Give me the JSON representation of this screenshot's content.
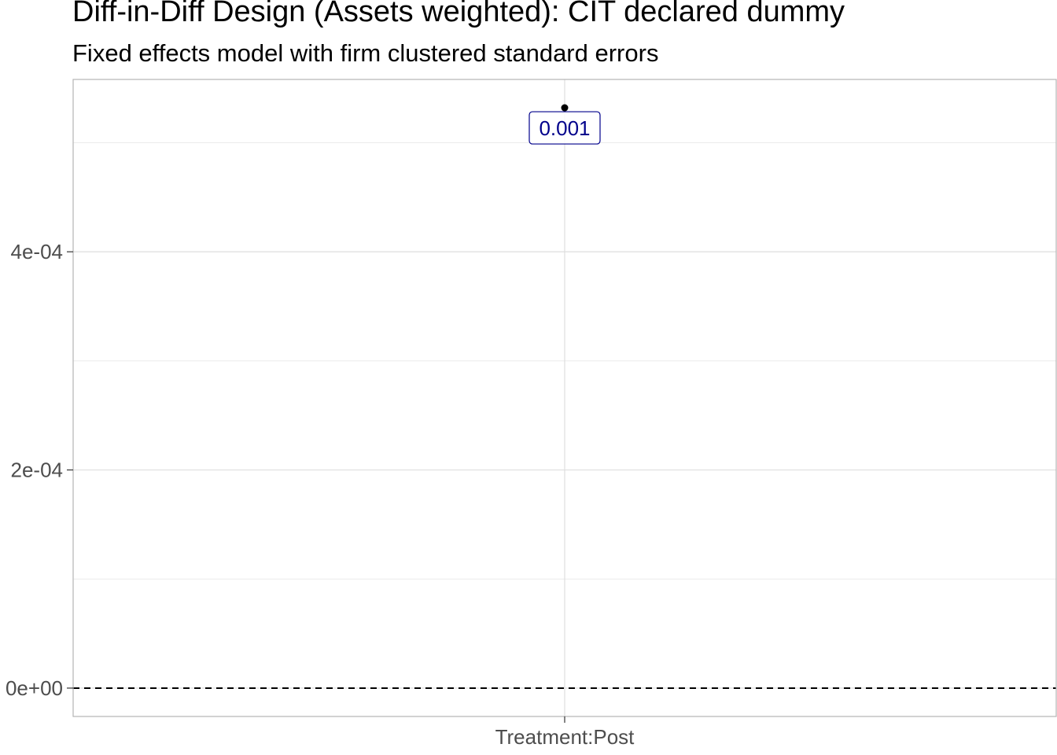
{
  "chart_data": {
    "type": "scatter",
    "title": "Diff-in-Diff Design (Assets weighted): CIT declared dummy",
    "subtitle": "Fixed effects model with firm clustered standard errors",
    "categories": [
      "Treatment:Post"
    ],
    "series": [
      {
        "values": [
          0.000532
        ],
        "labels": [
          "0.001"
        ]
      }
    ],
    "ylim": [
      -2.6e-05,
      0.000558
    ],
    "yticks": [
      0,
      0.0002,
      0.0004
    ],
    "ytick_labels": [
      "0e+00",
      "2e-04",
      "4e-04"
    ],
    "reference_line": {
      "y": 0,
      "style": "dashed"
    },
    "grid": true,
    "label_color": "#00008b",
    "point_color": "#000000"
  }
}
